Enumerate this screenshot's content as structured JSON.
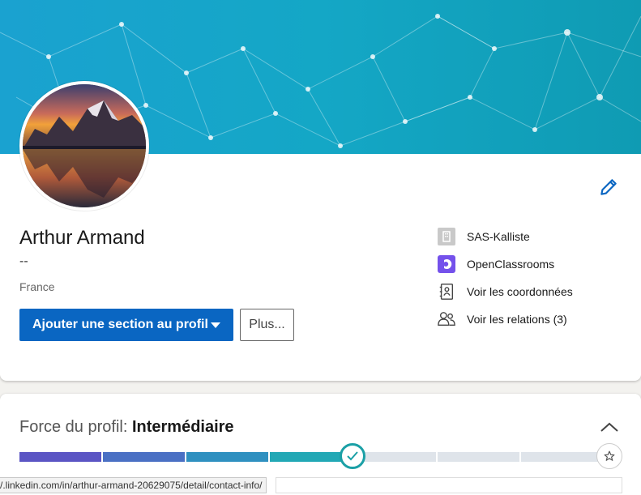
{
  "profile": {
    "name": "Arthur Armand",
    "headline": "--",
    "location": "France",
    "add_section_label": "Ajouter une section au profil",
    "more_label": "Plus...",
    "side": {
      "company": "SAS-Kalliste",
      "school": "OpenClassrooms",
      "contact": "Voir les coordonnées",
      "connections": "Voir les relations (3)"
    }
  },
  "strength": {
    "title_prefix": "Force du profil: ",
    "level": "Intermédiaire",
    "progress_fraction": 0.6
  },
  "status_bar": {
    "url": "/.linkedin.com/in/arthur-armand-20629075/detail/contact-info/"
  },
  "icons": {
    "edit": "pencil-icon",
    "company": "building-icon",
    "school": "openclassrooms-logo-icon",
    "contact": "address-book-icon",
    "connections": "people-icon",
    "add_caret": "caret-down-icon",
    "collapse": "chevron-up-icon",
    "check": "check-icon",
    "star": "star-icon"
  },
  "colors": {
    "primary": "#0a66c2",
    "banner": "#14a7c6",
    "meter_done": [
      "#5b55c4",
      "#4a70c4",
      "#2f90c0",
      "#22a8b5"
    ],
    "meter_todo": "#dfe4ea",
    "check_ring": "#1ba0a6"
  }
}
